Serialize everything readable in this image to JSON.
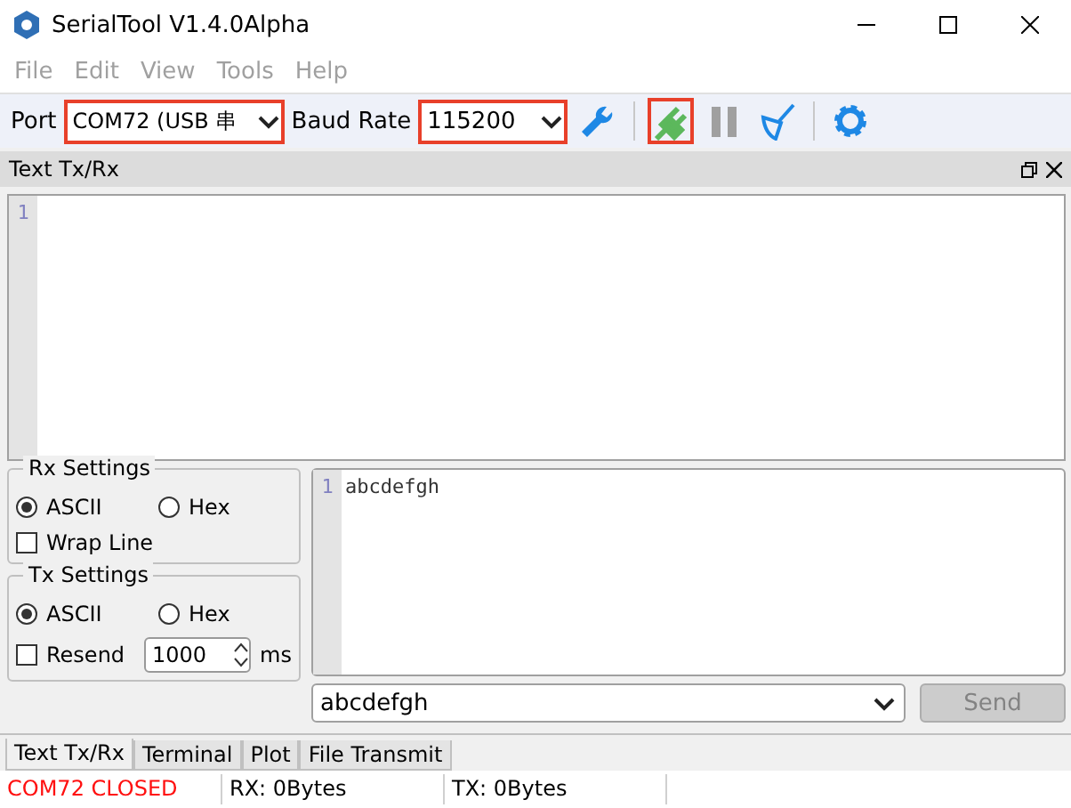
{
  "window": {
    "title": "SerialTool V1.4.0Alpha"
  },
  "menu": [
    {
      "label": "File",
      "disabled": true
    },
    {
      "label": "Edit",
      "disabled": true
    },
    {
      "label": "View",
      "disabled": true
    },
    {
      "label": "Tools",
      "disabled": true
    },
    {
      "label": "Help",
      "disabled": true
    }
  ],
  "toolbar": {
    "port": {
      "label": "Port",
      "value": "COM72 (USB 串",
      "highlighted": true
    },
    "baud": {
      "label": "Baud Rate",
      "value": "115200",
      "highlighted": true
    },
    "buttons": [
      {
        "kind": "wrench",
        "highlighted": false
      },
      {
        "kind": "separator"
      },
      {
        "kind": "plug",
        "highlighted": true
      },
      {
        "kind": "pause",
        "highlighted": false
      },
      {
        "kind": "broom",
        "highlighted": false
      },
      {
        "kind": "separator"
      },
      {
        "kind": "gear",
        "highlighted": false
      }
    ]
  },
  "dock": {
    "title": "Text Tx/Rx"
  },
  "rx_editor": {
    "line_numbers": [
      "1"
    ]
  },
  "rx_settings": {
    "title": "Rx Settings",
    "options": [
      {
        "label": "ASCII",
        "selected": true
      },
      {
        "label": "Hex",
        "selected": false
      }
    ],
    "wrap": {
      "label": "Wrap Line",
      "checked": false
    }
  },
  "tx_settings": {
    "title": "Tx Settings",
    "options": [
      {
        "label": "ASCII",
        "selected": true
      },
      {
        "label": "Hex",
        "selected": false
      }
    ],
    "resend": {
      "label": "Resend",
      "checked": false,
      "value": "1000",
      "unit": "ms"
    }
  },
  "tx_editor": {
    "lines": [
      {
        "number": "1",
        "text": "abcdefgh"
      }
    ]
  },
  "send": {
    "value": "abcdefgh",
    "button": "Send",
    "disabled": true
  },
  "tabs": [
    {
      "label": "Text Tx/Rx",
      "selected": true
    },
    {
      "label": "Terminal",
      "selected": false
    },
    {
      "label": "Plot",
      "selected": false
    },
    {
      "label": "File Transmit",
      "selected": false
    }
  ],
  "status": [
    {
      "text": "COM72 CLOSED",
      "kind": "error"
    },
    {
      "text": "RX: 0Bytes",
      "kind": "normal"
    },
    {
      "text": "TX: 0Bytes",
      "kind": "normal"
    }
  ]
}
